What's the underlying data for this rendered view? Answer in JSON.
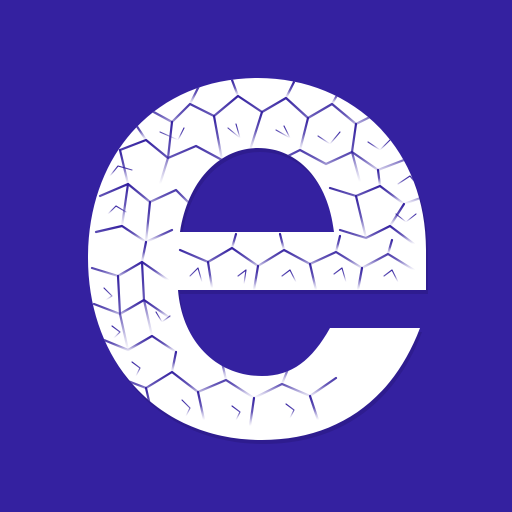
{
  "icon": {
    "glyph": "e",
    "background_color": "#3421a0",
    "glyph_color": "#ffffff",
    "crack_color": "#3421a0",
    "texture": "cracked-surface"
  }
}
